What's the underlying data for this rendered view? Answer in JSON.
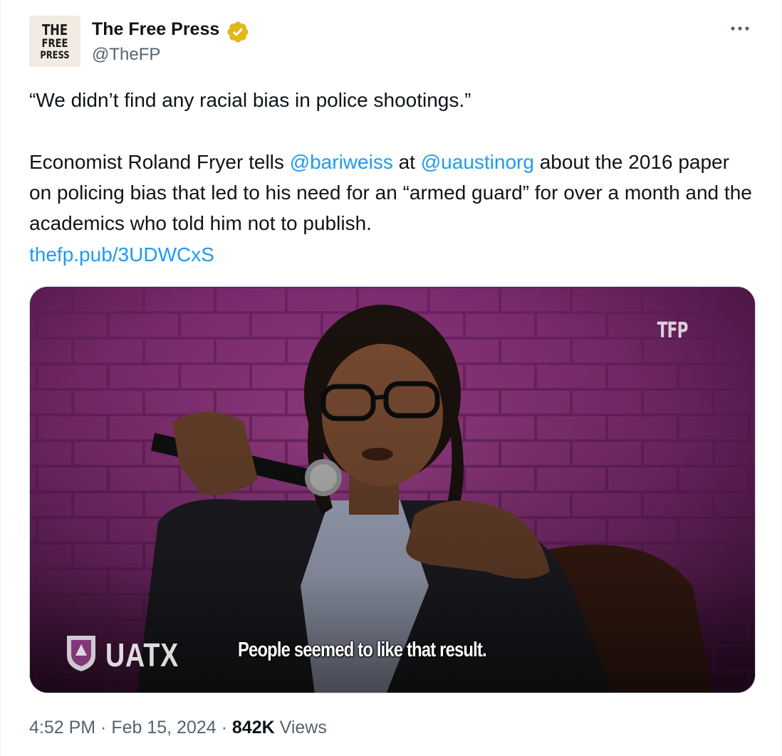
{
  "author": {
    "avatar_lines": [
      "THE",
      "FREE",
      "PRESS"
    ],
    "display_name": "The Free Press",
    "handle": "@TheFP",
    "verified_badge_color": "#e2b719",
    "more_icon": "ellipsis-icon"
  },
  "tweet": {
    "line1": "“We didn’t find any racial bias in police shootings.”",
    "para2_part1": "Economist Roland Fryer tells ",
    "mention1": "@bariweiss",
    "para2_part2": " at ",
    "mention2": "@uaustinorg",
    "para2_part3": " about the 2016 paper on policing bias that led to his need for an “armed guard” for over a month and the academics who told him not to publish.",
    "link": "thefp.pub/3UDWCxS"
  },
  "media": {
    "watermark": "TFP",
    "logo_text": "UATX",
    "caption": "People seemed to like that result.",
    "background_color": "#7a2a6e"
  },
  "meta": {
    "time": "4:52 PM",
    "separator": " · ",
    "date": "Feb 15, 2024",
    "views_count": "842K",
    "views_label": " Views"
  },
  "colors": {
    "link": "#1d9bf0",
    "text": "#0f1419",
    "secondary": "#536471"
  }
}
